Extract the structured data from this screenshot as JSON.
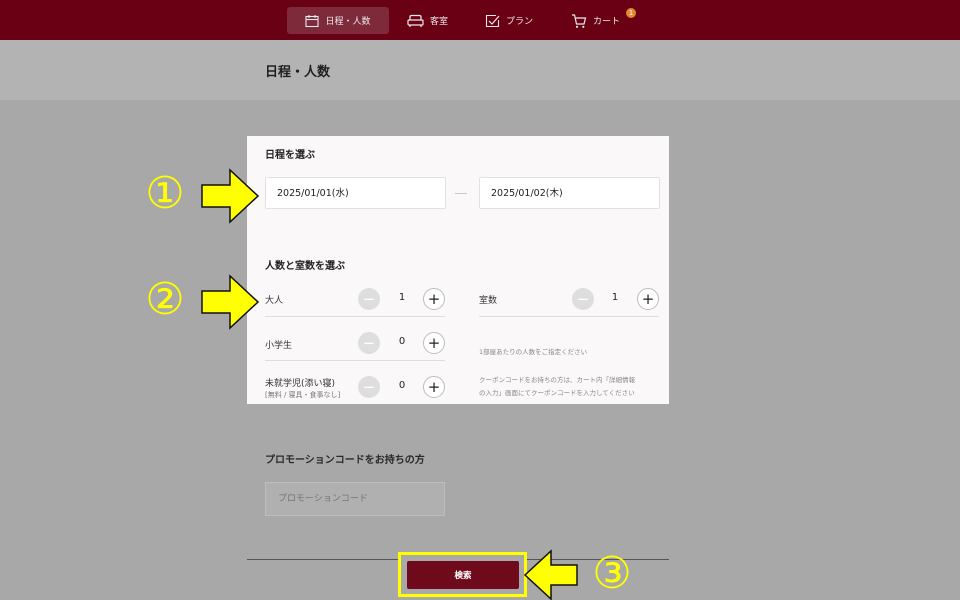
{
  "nav": {
    "items": [
      {
        "label": "日程・人数",
        "icon": "calendar-icon"
      },
      {
        "label": "客室",
        "icon": "sofa-icon"
      },
      {
        "label": "プラン",
        "icon": "plan-check-icon"
      },
      {
        "label": "カート",
        "icon": "cart-icon"
      }
    ],
    "cart_badge": "1",
    "active_bg": "#7f2a3b",
    "bar_color": "#6a0014"
  },
  "page": {
    "title": "日程・人数"
  },
  "dates": {
    "section_label": "日程を選ぶ",
    "checkin": "2025/01/01(水)",
    "checkout": "2025/01/02(木)"
  },
  "guests": {
    "section_label": "人数と室数を選ぶ",
    "adult": {
      "label": "大人",
      "count": "1"
    },
    "child": {
      "label": "小学生",
      "count": "0"
    },
    "infant": {
      "label": "未就学児(添い寝)",
      "sub": "[無料 / 寝具・食事なし]",
      "count": "0"
    },
    "rooms": {
      "label": "室数",
      "count": "1"
    },
    "note_per_room": "1部屋あたりの人数をご指定ください",
    "note_coupon_1": "クーポンコードをお持ちの方は、カート内「詳細情報",
    "note_coupon_2": "の入力」画面にてクーポンコードを入力してください"
  },
  "promo": {
    "label": "プロモーションコードをお持ちの方",
    "placeholder": "プロモーションコード"
  },
  "search": {
    "label": "検索"
  },
  "annotations": {
    "marker_1": "①",
    "marker_2": "②",
    "marker_3": "③",
    "color": "#ffff00"
  }
}
